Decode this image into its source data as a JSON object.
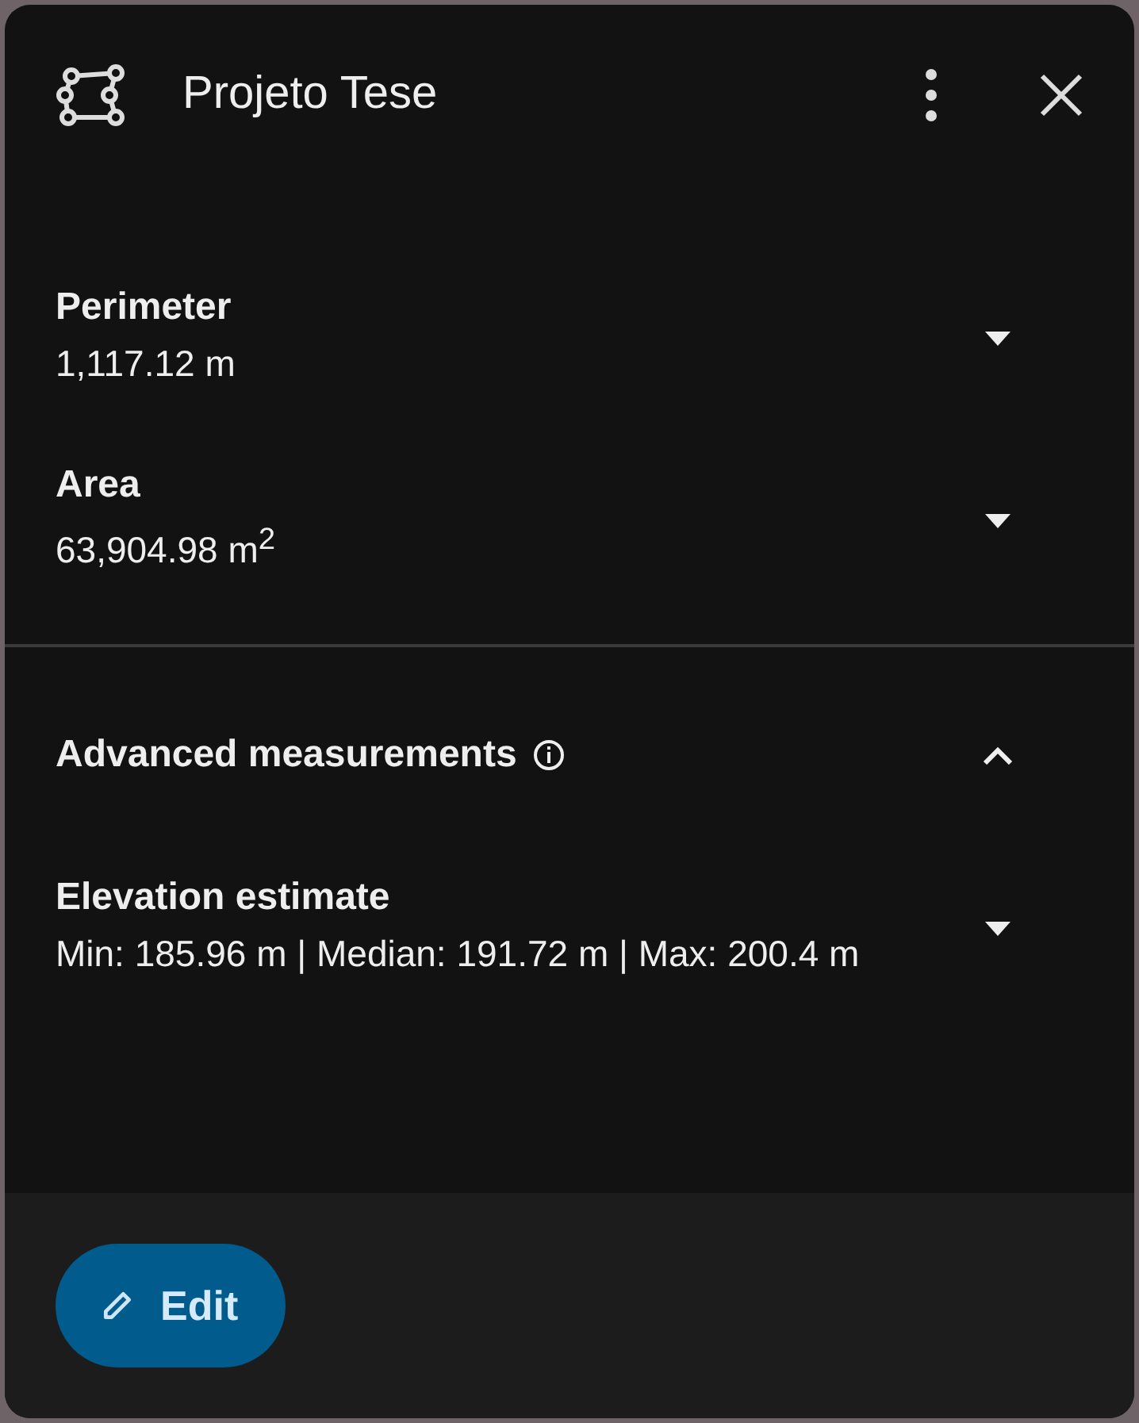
{
  "header": {
    "title": "Projeto Tese"
  },
  "measurements": [
    {
      "label": "Perimeter",
      "value": "1,117.12 m",
      "expanded": false
    },
    {
      "label": "Area",
      "value": "63,904.98 m$^{2}$",
      "expanded": false
    }
  ],
  "advanced": {
    "title": "Advanced measurements",
    "expanded": true,
    "items": [
      {
        "label": "Elevation estimate",
        "value": "Min: 185.96 m | Median: 191.72 m | Max: 200.4 m",
        "expanded": false
      }
    ]
  },
  "footer": {
    "button": "Edit"
  }
}
